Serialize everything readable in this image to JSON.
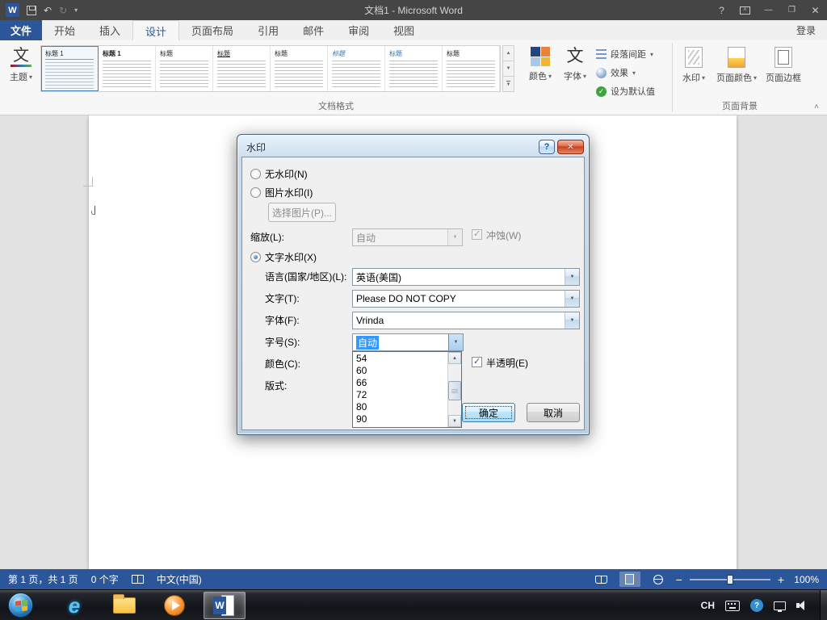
{
  "titlebar": {
    "title": "文档1 - Microsoft Word"
  },
  "ribbon": {
    "file_tab": "文件",
    "tabs": [
      {
        "label": "开始"
      },
      {
        "label": "插入"
      },
      {
        "label": "设计"
      },
      {
        "label": "页面布局"
      },
      {
        "label": "引用"
      },
      {
        "label": "邮件"
      },
      {
        "label": "审阅"
      },
      {
        "label": "视图"
      }
    ],
    "sign_in": "登录",
    "themes_label": "主题",
    "themes_glyph": "文",
    "gallery_items": [
      {
        "label": "标题 1"
      },
      {
        "label": "标题 1"
      },
      {
        "label": "标题"
      },
      {
        "label": "标题"
      },
      {
        "label": "标题"
      },
      {
        "label": "标题"
      },
      {
        "label": "标题"
      },
      {
        "label": "标题"
      }
    ],
    "colors_label": "颜色",
    "fonts_label": "字体",
    "fonts_glyph": "文",
    "paragraph_spacing_label": "段落间距",
    "effects_label": "效果",
    "set_default_label": "设为默认值",
    "watermark_label": "水印",
    "page_color_label": "页面颜色",
    "page_borders_label": "页面边框",
    "group_document_formatting": "文档格式",
    "group_page_background": "页面背景"
  },
  "dialog": {
    "title": "水印",
    "no_watermark_label": "无水印(N)",
    "picture_watermark_label": "图片水印(I)",
    "select_picture_label": "选择图片(P)...",
    "scale_label": "缩放(L):",
    "scale_value": "自动",
    "washout_label": "冲蚀(W)",
    "text_watermark_label": "文字水印(X)",
    "language_label": "语言(国家/地区)(L):",
    "language_value": "英语(美国)",
    "text_label": "文字(T):",
    "text_value": "Please DO NOT COPY",
    "font_label": "字体(F):",
    "font_value": "Vrinda",
    "size_label": "字号(S):",
    "size_value": "自动",
    "size_options": [
      {
        "value": "54"
      },
      {
        "value": "60"
      },
      {
        "value": "66"
      },
      {
        "value": "72"
      },
      {
        "value": "80"
      },
      {
        "value": "90"
      }
    ],
    "color_label": "颜色(C):",
    "semitransparent_label": "半透明(E)",
    "layout_label": "版式:",
    "ok_label": "确定",
    "cancel_label": "取消"
  },
  "status_bar": {
    "page_info": "第 1 页，共 1 页",
    "word_count": "0 个字",
    "language": "中文(中国)",
    "zoom_level": "100%"
  },
  "taskbar": {
    "tray_language": "CH"
  }
}
